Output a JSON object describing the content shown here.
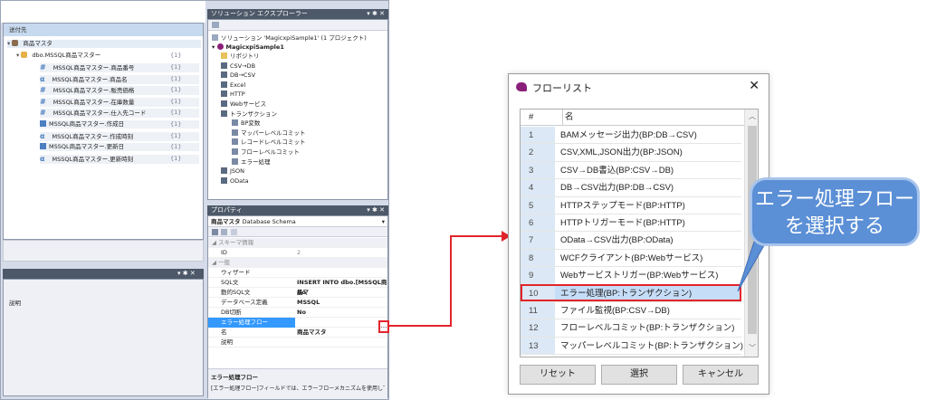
{
  "left_panel": {
    "header": "送付先",
    "root_label": "商品マスタ",
    "table_label": "dbo.MSSQL商品マスター",
    "table_count": "{1}",
    "fields": [
      {
        "type": "#",
        "label": "MSSQL商品マスター.商品番号",
        "count": "{1}"
      },
      {
        "type": "α",
        "label": "MSSQL商品マスター.商品名",
        "count": "{1}"
      },
      {
        "type": "#",
        "label": "MSSQL商品マスター.販売価格",
        "count": "{1}"
      },
      {
        "type": "#",
        "label": "MSSQL商品マスター.在庫数量",
        "count": "{1}"
      },
      {
        "type": "#",
        "label": "MSSQL商品マスター.仕入先コード",
        "count": "{1}"
      },
      {
        "type": "cal",
        "label": "MSSQL商品マスター.作成日",
        "count": "{1}"
      },
      {
        "type": "α",
        "label": "MSSQL商品マスター.作成時刻",
        "count": "{1}"
      },
      {
        "type": "cal",
        "label": "MSSQL商品マスター.更新日",
        "count": "{1}"
      },
      {
        "type": "α",
        "label": "MSSQL商品マスター.更新時刻",
        "count": "{1}"
      }
    ],
    "bottom_label": "説明"
  },
  "solution_explorer": {
    "title": "ソリューション エクスプローラー",
    "title_buttons": "▾ ✱ ✕",
    "solution": "ソリューション 'MagicxpiSample1' (1 プロジェクト)",
    "project": "MagicxpiSample1",
    "items": [
      "リポジトリ",
      "CSV→DB",
      "DB→CSV",
      "Excel",
      "HTTP",
      "Webサービス",
      "トランザクション"
    ],
    "sub_items": [
      "BP変数",
      "マッパーレベルコミット",
      "レコードレベルコミット",
      "フローレベルコミット",
      "エラー処理"
    ],
    "after_items": [
      "JSON",
      "OData"
    ]
  },
  "properties": {
    "title": "プロパティ",
    "title_buttons": "▾ ✱ ✕",
    "object_name": "商品マスタ",
    "object_type": "Database Schema",
    "cat1": "スキーマ情報",
    "cat2": "一般",
    "rows1": [
      {
        "k": "ID",
        "v": "2"
      }
    ],
    "rows2": [
      {
        "k": "ウィザード",
        "v": ""
      },
      {
        "k": "SQL文",
        "v": "INSERT INTO dbo.[MSSQL商品マ"
      },
      {
        "k": "動的SQL文",
        "v": "No"
      },
      {
        "k": "データベース定義",
        "v": "MSSQL"
      },
      {
        "k": "DB切断",
        "v": "No"
      },
      {
        "k": "エラー処理フロー",
        "v": ""
      },
      {
        "k": "名",
        "v": "商品マスタ"
      },
      {
        "k": "説明",
        "v": ""
      }
    ],
    "desc_title": "エラー処理フロー",
    "desc_text": "[エラー処理フロー]フィールドでは、エラーフローメカニズムを使用して例..."
  },
  "flow_dialog": {
    "title": "フローリスト",
    "close": "✕",
    "col_num": "#",
    "col_name": "名",
    "rows": [
      {
        "n": "1",
        "name": "BAMメッセージ出力(BP:DB→CSV)"
      },
      {
        "n": "2",
        "name": "CSV,XML,JSON出力(BP:JSON)"
      },
      {
        "n": "3",
        "name": "CSV→DB書込(BP:CSV→DB)"
      },
      {
        "n": "4",
        "name": "DB→CSV出力(BP:DB→CSV)"
      },
      {
        "n": "5",
        "name": "HTTPステップモード(BP:HTTP)"
      },
      {
        "n": "6",
        "name": "HTTPトリガーモード(BP:HTTP)"
      },
      {
        "n": "7",
        "name": "OData→CSV出力(BP:OData)"
      },
      {
        "n": "8",
        "name": "WCFクライアント(BP:Webサービス)"
      },
      {
        "n": "9",
        "name": "Webサービストリガー(BP:Webサービス)"
      },
      {
        "n": "10",
        "name": "エラー処理(BP:トランザクション)"
      },
      {
        "n": "11",
        "name": "ファイル監視(BP:CSV→DB)"
      },
      {
        "n": "12",
        "name": "フローレベルコミット(BP:トランザクション)"
      },
      {
        "n": "13",
        "name": "マッパーレベルコミット(BP:トランザクション)"
      }
    ],
    "buttons": {
      "reset": "リセット",
      "select": "選択",
      "cancel": "キャンセル"
    }
  },
  "callout": {
    "line1": "エラー処理フロー",
    "line2": "を選択する"
  },
  "colors": {
    "accent": "#e3242b",
    "callout_bg": "#5b8fd6",
    "selection": "#3399ff"
  }
}
